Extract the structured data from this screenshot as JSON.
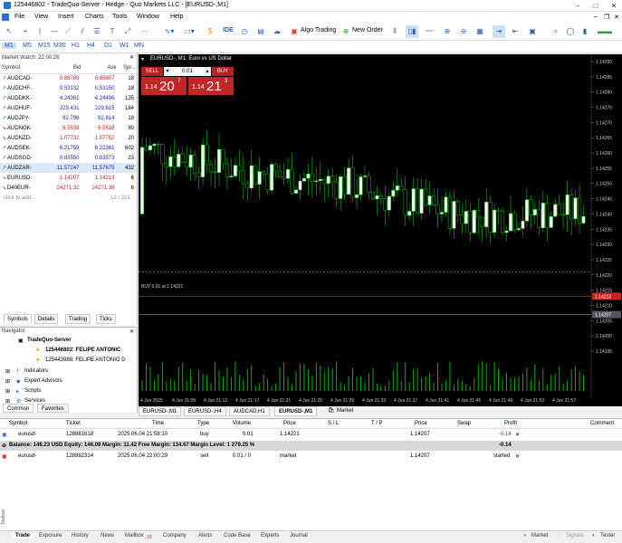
{
  "window": {
    "title": "125446802 - TradeQuo-Server - Hedge - Quo Markets LLC - [EURUSD-,M1]"
  },
  "menu": [
    "File",
    "View",
    "Insert",
    "Charts",
    "Tools",
    "Window",
    "Help"
  ],
  "toolbar": {
    "algo_trading": "Algo Trading",
    "new_order": "New Order",
    "ide": "IDE"
  },
  "timeframes": [
    "M1",
    "M5",
    "M15",
    "M30",
    "H1",
    "H4",
    "D1",
    "W1",
    "MN"
  ],
  "market_watch": {
    "header": "Market Watch: 22:00:29",
    "columns": [
      "Symbol",
      "Bid",
      "Ask",
      "Spr..."
    ],
    "rows": [
      {
        "symbol": "AUDCAD-",
        "bid": "0.88789",
        "ask": "0.88807",
        "spread": "18",
        "dir": "up",
        "color": "dn"
      },
      {
        "symbol": "AUDCHF-",
        "bid": "0.53132",
        "ask": "0.53150",
        "spread": "18",
        "dir": "up",
        "color": "up"
      },
      {
        "symbol": "AUDDKK-",
        "bid": "4.24361",
        "ask": "4.24496",
        "spread": "135",
        "dir": "up",
        "color": "up"
      },
      {
        "symbol": "AUDHUF-",
        "bid": "229.431",
        "ask": "229.615",
        "spread": "184",
        "dir": "up",
        "color": "up"
      },
      {
        "symbol": "AUDJPY-",
        "bid": "92.796",
        "ask": "92.814",
        "spread": "18",
        "dir": "up",
        "color": "up"
      },
      {
        "symbol": "AUDNOK-",
        "bid": "6.5538",
        "ask": "6.5618",
        "spread": "80",
        "dir": "dn",
        "color": "dn"
      },
      {
        "symbol": "AUDNZD-",
        "bid": "1.07732",
        "ask": "1.07752",
        "spread": "20",
        "dir": "dn",
        "color": "dn"
      },
      {
        "symbol": "AUDSEK-",
        "bid": "6.21759",
        "ask": "6.22361",
        "spread": "602",
        "dir": "up",
        "color": "up"
      },
      {
        "symbol": "AUDSGD-",
        "bid": "0.83550",
        "ask": "0.83573",
        "spread": "23",
        "dir": "up",
        "color": "up"
      },
      {
        "symbol": "AUDZAR-",
        "bid": "11.57247",
        "ask": "11.57679",
        "spread": "432",
        "dir": "up",
        "color": "up"
      },
      {
        "symbol": "EURUSD-",
        "bid": "1.14207",
        "ask": "1.14213",
        "spread": "6",
        "dir": "dn",
        "color": "dn"
      },
      {
        "symbol": "D40EUR-",
        "bid": "24271.32",
        "ask": "24271.38",
        "spread": "6",
        "dir": "dn",
        "color": "dn"
      }
    ],
    "add_hint": "click to add...",
    "count": "12 / 221",
    "tabs": [
      "Symbols",
      "Details",
      "Trading",
      "Ticks"
    ]
  },
  "navigator": {
    "header": "Navigator",
    "server": "TradeQuo-Server",
    "account1": "125446802: FELIPE ANTONIC",
    "account2": "125443988: FELIPE ANTONIO D",
    "items": [
      "Indicators",
      "Expert Advisors",
      "Scripts",
      "Services"
    ],
    "tabs": [
      "Common",
      "Favorites"
    ]
  },
  "chart": {
    "symbol_label": "EURUSD-, M1:  Euro vs US Dollar",
    "sell_label": "SELL",
    "buy_label": "BUY",
    "lot": "0.01",
    "sell_price_big": "20",
    "sell_price_small": "1.14",
    "sell_price_sup": "7",
    "buy_price_big": "21",
    "buy_price_small": "1.14",
    "buy_price_sup": "3",
    "buy_line_label": "BUY 0.01 at 1.14221",
    "price_axis": [
      "1.14290",
      "1.14285",
      "1.14280",
      "1.14275",
      "1.14270",
      "1.14265",
      "1.14260",
      "1.14255",
      "1.14250",
      "1.14245",
      "1.14240",
      "1.14235",
      "1.14230",
      "1.14225",
      "1.14220",
      "1.14215",
      "1.14210",
      "1.14205",
      "1.14200",
      "1.14195"
    ],
    "bid_tag": "1.14213",
    "ask_tag": "1.14207",
    "time_axis": [
      "4 Jun 2025",
      "4 Jun 21:09",
      "4 Jun 21:13",
      "4 Jun 21:17",
      "4 Jun 21:21",
      "4 Jun 21:25",
      "4 Jun 21:29",
      "4 Jun 21:33",
      "4 Jun 21:37",
      "4 Jun 21:41",
      "4 Jun 21:45",
      "4 Jun 21:49",
      "4 Jun 21:53",
      "4 Jun 21:57"
    ],
    "colors": {
      "bull": "#ffffff",
      "bear": "#000000",
      "wick": "#00c800",
      "volume": "#00c800",
      "bid_line": "#cc2222",
      "ask_line": "#8899bb"
    }
  },
  "chart_tabs": [
    "EURUSD-,M1",
    "EURUSD-,H4",
    "AUDCAD,H1",
    "EURUSD-,M1",
    "Market"
  ],
  "trade": {
    "columns": [
      "Symbol",
      "Ticket",
      "Time",
      "Type",
      "Volume",
      "Price",
      "S / L",
      "T / P",
      "Price",
      "Swap",
      "Profit",
      "Comment"
    ],
    "position": {
      "symbol": "eurusd-",
      "ticket": "128881618",
      "time": "2025.06.04 21:58:10",
      "type": "buy",
      "volume": "0.01",
      "price": "1.14221",
      "price2": "1.14207",
      "profit": "-0.14"
    },
    "balance_line": "Balance: 146.23 USD  Equity: 146.09  Margin: 11.42  Free Margin: 134.67  Margin Level: 1 279.25 %",
    "balance_profit": "-0.14",
    "order": {
      "symbol": "eurusd-",
      "ticket": "128882314",
      "time": "2025.06.04 22:00:29",
      "type": "sell",
      "volume": "0.01 / 0",
      "price": "market",
      "price2": "1.14207",
      "status": "started"
    }
  },
  "bottom_tabs": [
    "Trade",
    "Exposure",
    "History",
    "News",
    "Mailbox",
    "Company",
    "Alerts",
    "Code Base",
    "Experts",
    "Journal"
  ],
  "mailbox_badge": "10",
  "status": {
    "market": "Market",
    "signals": "Signals",
    "tester": "Tester"
  },
  "toolbox_label": "Toolbox"
}
